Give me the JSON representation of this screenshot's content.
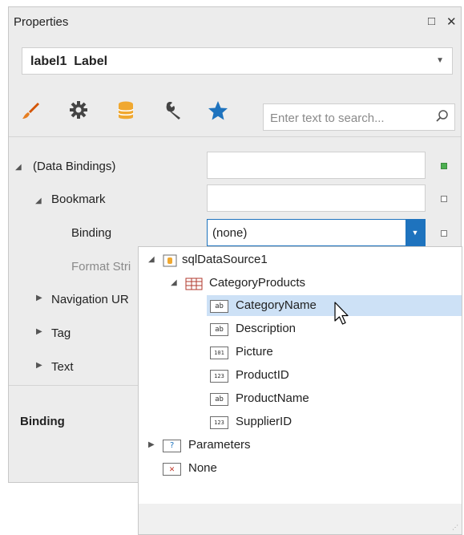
{
  "window": {
    "title": "Properties",
    "maximize_glyph": "□",
    "close_glyph": "✕"
  },
  "object_selector": {
    "name": "label1",
    "type": "Label"
  },
  "toolbar": {
    "icons": [
      "brush-icon",
      "gear-icon",
      "database-icon",
      "wrench-icon",
      "star-icon"
    ],
    "accent": "#1e73be"
  },
  "search": {
    "placeholder": "Enter text to search..."
  },
  "properties": {
    "data_bindings": {
      "label": "(Data Bindings)",
      "value": ""
    },
    "bookmark": {
      "label": "Bookmark",
      "value": ""
    },
    "binding": {
      "label": "Binding",
      "value": "(none)"
    },
    "format_string": {
      "label": "Format Stri"
    },
    "navigation_url": {
      "label": "Navigation UR"
    },
    "tag": {
      "label": "Tag"
    },
    "text": {
      "label": "Text"
    }
  },
  "description": {
    "title": "Binding"
  },
  "dropdown_tree": {
    "datasource": "sqlDataSource1",
    "table": "CategoryProducts",
    "fields": [
      {
        "label": "CategoryName",
        "icon": "ab",
        "selected": true
      },
      {
        "label": "Description",
        "icon": "ab",
        "selected": false
      },
      {
        "label": "Picture",
        "icon": "101",
        "selected": false
      },
      {
        "label": "ProductID",
        "icon": "123",
        "selected": false
      },
      {
        "label": "ProductName",
        "icon": "ab",
        "selected": false
      },
      {
        "label": "SupplierID",
        "icon": "123",
        "selected": false
      }
    ],
    "parameters": "Parameters",
    "none": "None",
    "selected_color": "#cde1f6"
  }
}
